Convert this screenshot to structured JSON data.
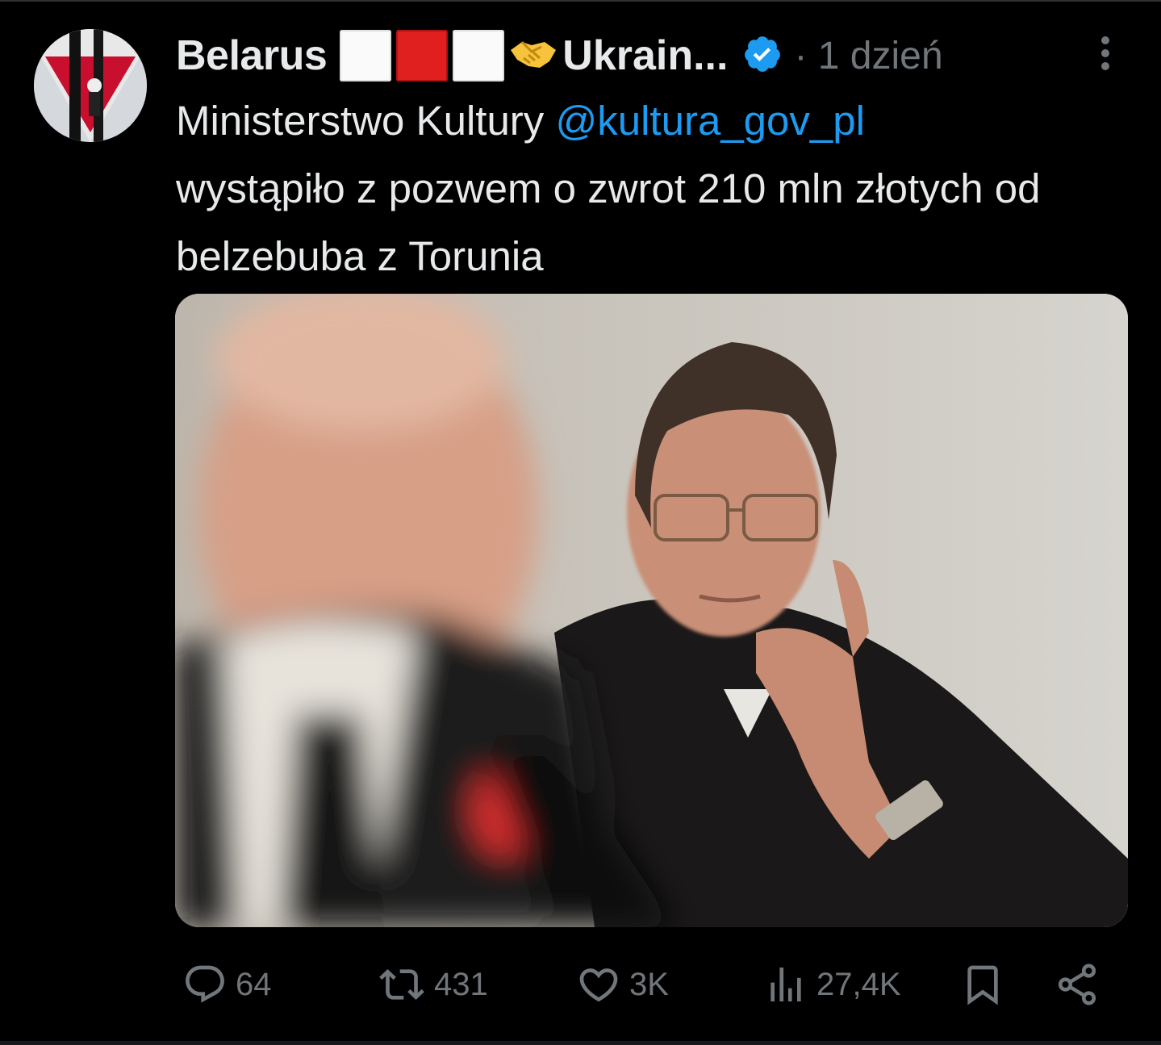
{
  "tweet": {
    "display_name": "Belarus",
    "name_tail": "Ukrain...",
    "time": "· 1 dzień",
    "text_prefix": "Ministerstwo Kultury ",
    "mention": "@kultura_gov_pl",
    "text_rest": "wystąpiło z pozwem o zwrot 210 mln złotych od belzebuba z Torunia"
  },
  "actions": {
    "replies": "64",
    "retweets": "431",
    "likes": "3K",
    "views": "27,4K"
  },
  "icons": [
    "avatar-image",
    "flag-icon",
    "handshake-icon",
    "verified-badge-icon",
    "more-options-icon",
    "reply-icon",
    "retweet-icon",
    "like-icon",
    "views-icon",
    "bookmark-icon",
    "share-icon"
  ],
  "colors": {
    "background": "#000000",
    "text": "#e7e9ea",
    "muted": "#71767b",
    "link": "#1d9bf0",
    "verified": "#1d9bf0"
  }
}
